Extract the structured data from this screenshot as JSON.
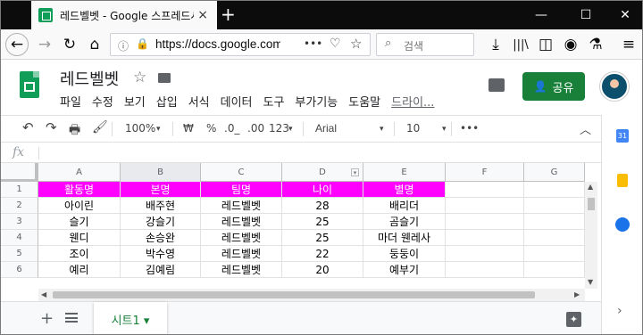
{
  "browser": {
    "tab_title": "레드벨벳 - Google 스프레드시",
    "tab_close": "×",
    "new_tab": "+",
    "url": "https://docs.google.com",
    "url_more": "•••",
    "search_placeholder": "검색",
    "window_controls": [
      "—",
      "☐",
      "✕"
    ]
  },
  "docs": {
    "title": "레드벨벳",
    "star": "☆",
    "menus": [
      "파일",
      "수정",
      "보기",
      "삽입",
      "서식",
      "데이터",
      "도구",
      "부가기능",
      "도움말",
      "드라이..."
    ],
    "share_label": "공유"
  },
  "toolbar": {
    "zoom": "100%",
    "currency": "₩",
    "percent": "%",
    "dec_decrease": ".0_",
    "dec_increase": ".00",
    "format_more": "123",
    "font": "Arial",
    "font_size": "10",
    "more": "•••"
  },
  "formula": {
    "fx": "fx"
  },
  "sheet": {
    "columns": [
      "A",
      "B",
      "C",
      "D",
      "E",
      "F",
      "G"
    ],
    "rows": [
      "1",
      "2",
      "3",
      "4",
      "5",
      "6"
    ],
    "header_color": "#ff00ff",
    "cells": [
      [
        "활동명",
        "본명",
        "팀명",
        "나이",
        "별명"
      ],
      [
        "아이린",
        "배주현",
        "레드벨벳",
        "28",
        "배리더"
      ],
      [
        "슬기",
        "강슬기",
        "레드벨벳",
        "25",
        "곰슬기"
      ],
      [
        "웬디",
        "손승완",
        "레드벨벳",
        "25",
        "마더 웬레사"
      ],
      [
        "조이",
        "박수영",
        "레드벨벳",
        "22",
        "둥둥이"
      ],
      [
        "예리",
        "김예림",
        "레드벨벳",
        "20",
        "예부기"
      ]
    ]
  },
  "bottom": {
    "add": "+",
    "sheet_tab": "시트1 ▾"
  },
  "side": {
    "calendar_text": "31"
  }
}
